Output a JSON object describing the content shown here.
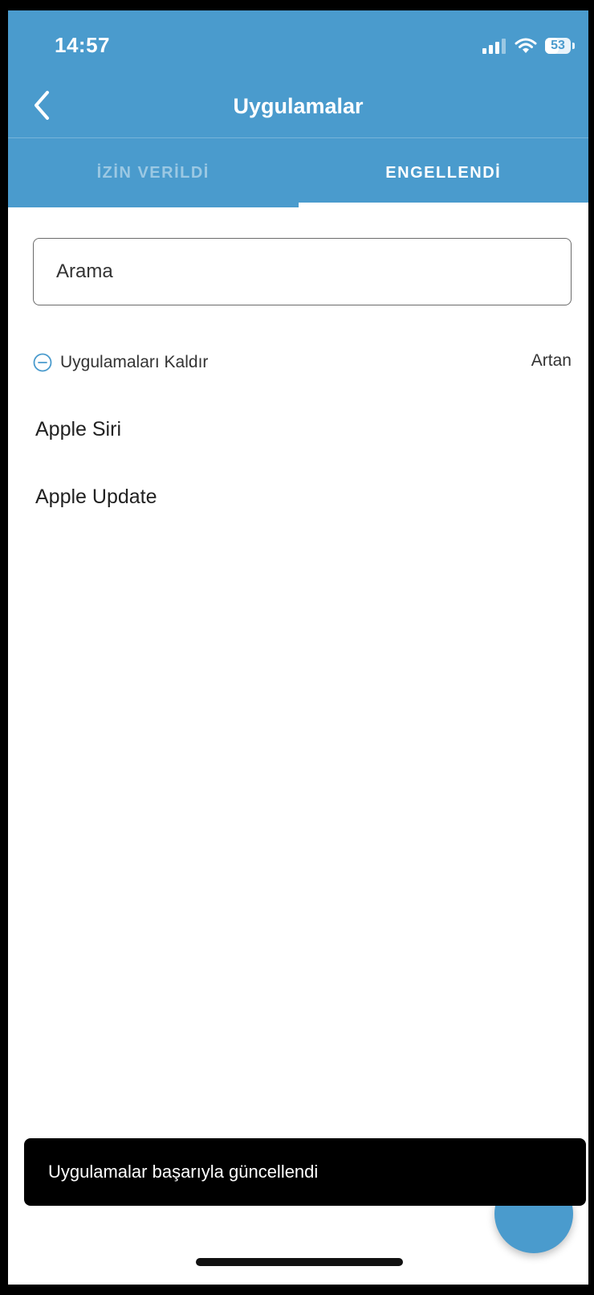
{
  "status_bar": {
    "time": "14:57",
    "battery": "53",
    "battery_level": 0.53,
    "icons": [
      "signal-icon",
      "wifi-icon",
      "battery-icon"
    ]
  },
  "nav": {
    "title": "Uygulamalar",
    "back_icon": "chevron-left-icon"
  },
  "tabs": [
    {
      "label": "İZİN VERİLDİ",
      "active": false
    },
    {
      "label": "ENGELLENDİ",
      "active": true
    }
  ],
  "search": {
    "placeholder": "Arama"
  },
  "list_controls": {
    "remove_label": "Uygulamaları Kaldır",
    "remove_icon": "minus-circle-icon",
    "sort_label": "Artan"
  },
  "apps": [
    {
      "name": "Apple Siri"
    },
    {
      "name": "Apple Update"
    }
  ],
  "snackbar": {
    "message": "Uygulamalar başarıyla güncellendi"
  },
  "fab": {
    "label": "+"
  },
  "colors": {
    "accent": "#4a9bcd",
    "text": "#333333",
    "snackbar": "#000000"
  }
}
